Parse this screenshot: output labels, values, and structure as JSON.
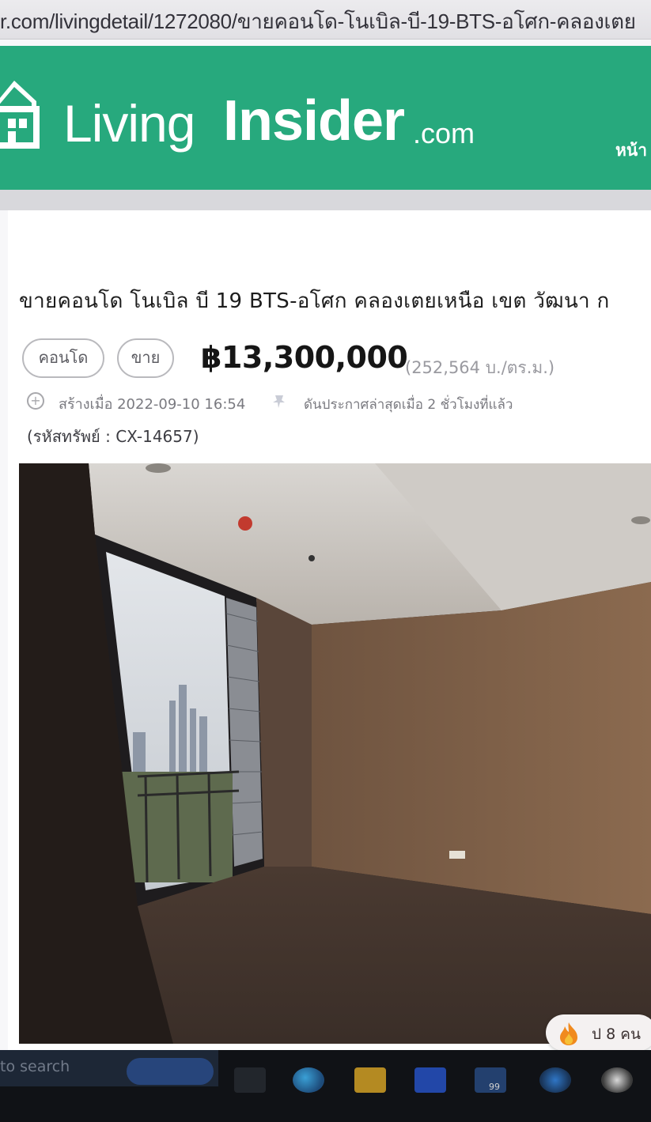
{
  "browser": {
    "url_text": "r.com/livingdetail/1272080/ขายคอนโด-โนเบิล-บี-19-BTS-อโศก-คลองเตย"
  },
  "header": {
    "brand_living": "Living",
    "brand_insider": "Insider",
    "brand_tld": ".com",
    "nav_home": "หน้า",
    "color": "#27a97d"
  },
  "listing": {
    "title": "ขายคอนโด โนเบิล บี 19 BTS-อโศก คลองเตยเหนือ เขต วัฒนา ก",
    "property_type": "คอนโด",
    "deal_type": "ขาย",
    "price": "฿13,300,000",
    "price_per_sqm": "(252,564 บ./ตร.ม.)",
    "created": "สร้างเมื่อ 2022-09-10 16:54",
    "bumped": "ดันประกาศล่าสุดเมื่อ 2 ชั่วโมงที่แล้ว",
    "property_code": "(รหัสทรัพย์ : CX-14657)",
    "icons": {
      "created": "plus-circle-icon",
      "bumped": "pin-icon"
    }
  },
  "photo": {
    "subject": "empty condo bedroom with floor-to-ceiling window"
  },
  "engagement": {
    "likes": "ป 8 คน",
    "icon": "fire-icon"
  },
  "taskbar": {
    "search_text": "to search",
    "badge": "99"
  }
}
